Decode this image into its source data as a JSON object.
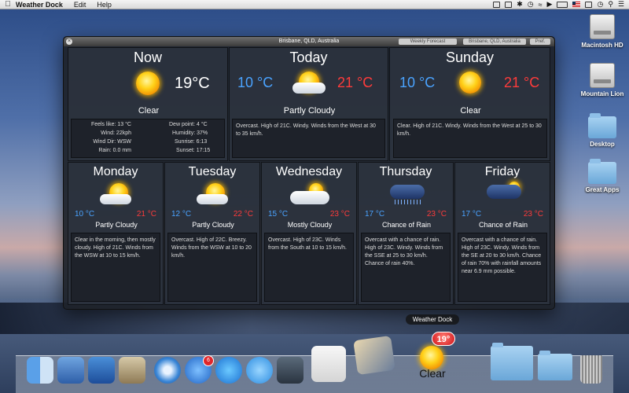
{
  "menubar": {
    "app_name": "Weather Dock",
    "items": [
      "Edit",
      "Help"
    ]
  },
  "desktop": {
    "icons": [
      {
        "label": "Macintosh HD"
      },
      {
        "label": "Mountain Lion"
      },
      {
        "label": "Desktop"
      },
      {
        "label": "Great Apps"
      }
    ]
  },
  "window": {
    "title": "Brisbane, QLD, Australia",
    "toolbar_fields": [
      "Weekly Forecast",
      "Brisbane, QLD, Australia",
      "Pref."
    ]
  },
  "now": {
    "title": "Now",
    "temp": "19°C",
    "condition": "Clear",
    "details": {
      "feels_like_label": "Feels like:",
      "feels_like": "13 °C",
      "wind_label": "Wind:",
      "wind": "22kph",
      "wind_dir_label": "Wind Dir:",
      "wind_dir": "WSW",
      "rain_label": "Rain:",
      "rain": "0.0 mm",
      "dew_point_label": "Dew point:",
      "dew_point": "4 °C",
      "humidity_label": "Humidity:",
      "humidity": "37%",
      "sunrise_label": "Sunrise:",
      "sunrise": "6:13",
      "sunset_label": "Sunset:",
      "sunset": "17:15"
    }
  },
  "today": {
    "title": "Today",
    "low": "10 °C",
    "high": "21 °C",
    "condition": "Partly Cloudy",
    "description": "Overcast. High of 21C. Windy. Winds from the West at 30 to 35 km/h."
  },
  "sunday": {
    "title": "Sunday",
    "low": "10 °C",
    "high": "21 °C",
    "condition": "Clear",
    "description": "Clear. High of 21C. Windy. Winds from the West at 25 to 30 km/h."
  },
  "forecast": [
    {
      "day": "Monday",
      "low": "10 °C",
      "high": "21 °C",
      "condition": "Partly Cloudy",
      "description": "Clear in the morning, then mostly cloudy. High of 21C. Winds from the WSW at 10 to 15 km/h."
    },
    {
      "day": "Tuesday",
      "low": "12 °C",
      "high": "22 °C",
      "condition": "Partly Cloudy",
      "description": "Overcast. High of 22C. Breezy. Winds from the WSW at 10 to 20 km/h."
    },
    {
      "day": "Wednesday",
      "low": "15 °C",
      "high": "23 °C",
      "condition": "Mostly Cloudy",
      "description": "Overcast. High of 23C. Winds from the South at 10 to 15 km/h."
    },
    {
      "day": "Thursday",
      "low": "17 °C",
      "high": "23 °C",
      "condition": "Chance of Rain",
      "description": "Overcast with a chance of rain. High of 23C. Windy. Winds from the SSE at 25 to 30 km/h. Chance of rain 40%."
    },
    {
      "day": "Friday",
      "low": "17 °C",
      "high": "23 °C",
      "condition": "Chance of Rain",
      "description": "Overcast with a chance of rain. High of 23C. Windy. Winds from the SE at 20 to 30 km/h. Chance of rain 70% with rainfall amounts near 6.9 mm possible."
    }
  ],
  "dock": {
    "tooltip": "Weather Dock",
    "weather_badge": "19°",
    "weather_label": "Clear",
    "appstore_badge": "6"
  },
  "icons": {
    "now": "sun-icon",
    "partly_cloudy": "partly-cloudy-icon",
    "mostly_cloudy": "mostly-cloudy-icon",
    "rain": "rain-cloud-icon"
  }
}
